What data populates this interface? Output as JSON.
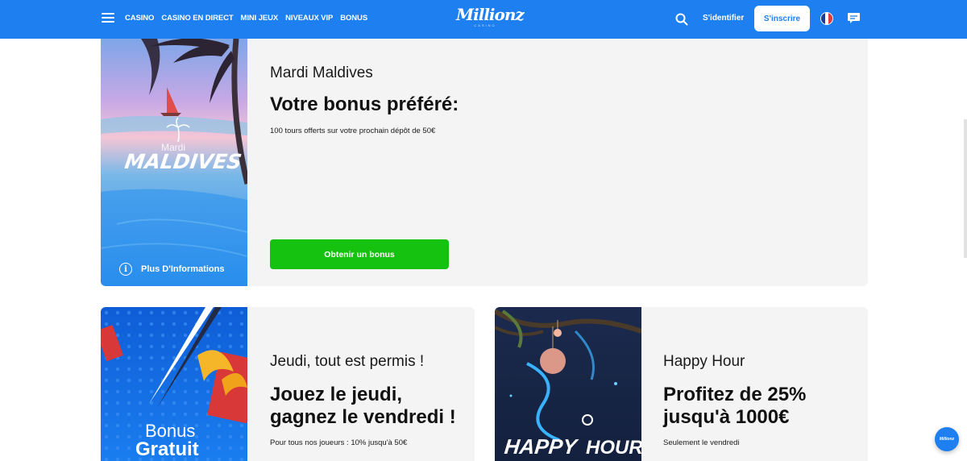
{
  "header": {
    "nav": [
      "CASINO",
      "CASINO EN DIRECT",
      "MINI JEUX",
      "NIVEAUX VIP",
      "BONUS"
    ],
    "logo": "Millionz",
    "logo_sub": "CASINO",
    "signin": "S'identifier",
    "signup": "S'inscrire",
    "icons": [
      "menu-icon",
      "search-icon",
      "flag-fr-icon",
      "chat-icon"
    ]
  },
  "promo_main": {
    "subtitle": "Mardi Maldives",
    "title": "Votre bonus préféré:",
    "desc": "100 tours offerts sur votre prochain dépôt de 50€",
    "button": "Obtenir un bonus",
    "image_text_small": "Mardi",
    "image_text_big": "MALDIVES",
    "info_link": "Plus D'Informations"
  },
  "promo_thursday": {
    "subtitle": "Jeudi, tout est permis !",
    "title_line1": "Jouez le jeudi,",
    "title_line2": "gagnez le vendredi !",
    "desc": "Pour tous nos joueurs : 10% jusqu'à 50€",
    "image_line1": "Bonus",
    "image_line2": "Gratuit"
  },
  "promo_happy": {
    "subtitle": "Happy Hour",
    "title_line1": "Profitez de 25%",
    "title_line2": "jusqu'à 1000€",
    "desc": "Seulement le vendredi",
    "image_text_1": "HAPPY",
    "image_text_2": "HOUR"
  },
  "fab_label": "Millionz",
  "colors": {
    "brand": "#1d7ff0",
    "cta": "#14c20f",
    "card_bg": "#f4f4f5"
  }
}
